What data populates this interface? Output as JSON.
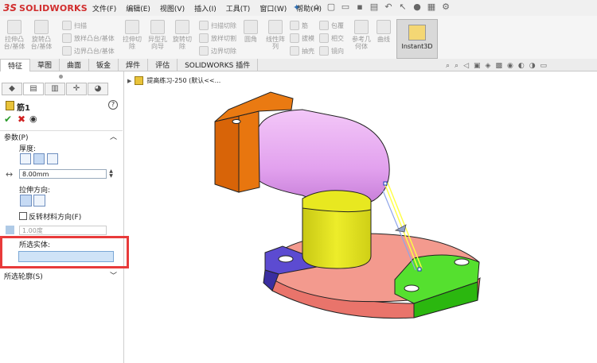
{
  "app": {
    "logo_mark": "3S",
    "logo_text": "SOLIDWORKS"
  },
  "menu": [
    "文件(F)",
    "编辑(E)",
    "视图(V)",
    "插入(I)",
    "工具(T)",
    "窗口(W)",
    "帮助(H)"
  ],
  "toolbar": {
    "extrude_boss": "拉伸凸台/基体",
    "revolve_boss": "旋转凸台/基体",
    "sweep": "扫描",
    "loft": "放样凸台/基体",
    "boundary": "边界凸台/基体",
    "extrude_cut": "拉伸切除",
    "hole_wizard": "异型孔向导",
    "revolve_cut": "旋转切除",
    "swept_cut": "扫描切除",
    "lofted_cut": "放样切割",
    "boundary_cut": "边界切除",
    "fillet": "圆角",
    "linear_pattern": "线性阵列",
    "rib": "筋",
    "draft": "拔模",
    "shell": "抽壳",
    "wrap": "包覆",
    "intersect": "相交",
    "mirror": "镜向",
    "ref_geometry": "参考几何体",
    "curves": "曲线",
    "instant3d": "Instant3D"
  },
  "tabs": [
    "特征",
    "草图",
    "曲面",
    "钣金",
    "焊件",
    "评估",
    "SOLIDWORKS 插件"
  ],
  "panel": {
    "feature_name": "筋1",
    "help": "?",
    "params_title": "参数(P)",
    "thickness_label": "厚度:",
    "thickness_value": "8.00mm",
    "direction_label": "拉伸方向:",
    "flip_label": "反转材料方向(F)",
    "draft_value": "1.00度",
    "selected_bodies_label": "所选实体:",
    "selected_contours_label": "所选轮廓(S)"
  },
  "viewport": {
    "tree_item": "提高练习-250  (默认<<..."
  },
  "colors": {
    "base": "#f39a8e",
    "left_lug": "#5c4bd1",
    "right_lug": "#55e02f",
    "column": "#e8e820",
    "elbow": "#e7a7f1",
    "end_block": "#e8760f",
    "highlight": "#e83a3a"
  }
}
